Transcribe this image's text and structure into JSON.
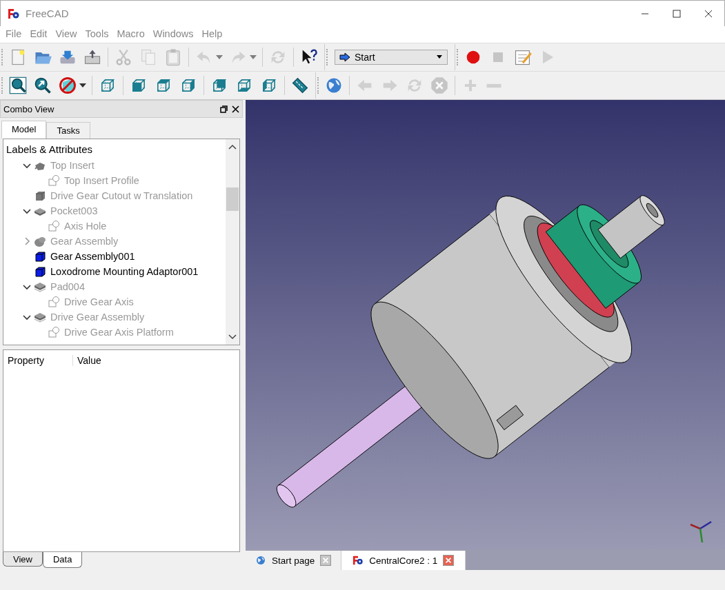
{
  "window": {
    "title": "FreeCAD"
  },
  "menu": [
    "File",
    "Edit",
    "View",
    "Tools",
    "Macro",
    "Windows",
    "Help"
  ],
  "toolbar_top": [
    {
      "kind": "new",
      "disabled": false
    },
    {
      "kind": "open",
      "disabled": false
    },
    {
      "kind": "save",
      "disabled": false
    },
    {
      "kind": "export",
      "disabled": false
    },
    {
      "kind": "sep"
    },
    {
      "kind": "cut",
      "disabled": true
    },
    {
      "kind": "copy",
      "disabled": true
    },
    {
      "kind": "paste",
      "disabled": true
    },
    {
      "kind": "sep"
    },
    {
      "kind": "undo",
      "disabled": true,
      "menu": true
    },
    {
      "kind": "redo",
      "disabled": true,
      "menu": true
    },
    {
      "kind": "sep"
    },
    {
      "kind": "refresh",
      "disabled": true
    },
    {
      "kind": "sep"
    },
    {
      "kind": "whatsthis",
      "disabled": false
    }
  ],
  "macro_toolbar": {
    "workbench": "Start",
    "buttons": [
      {
        "kind": "record",
        "disabled": false
      },
      {
        "kind": "stop",
        "disabled": true
      },
      {
        "kind": "editor",
        "disabled": false
      },
      {
        "kind": "play",
        "disabled": true
      }
    ]
  },
  "toolbar_view": [
    {
      "kind": "fit-all",
      "disabled": false
    },
    {
      "kind": "fit-selection",
      "disabled": false
    },
    {
      "kind": "drawstyle",
      "disabled": false,
      "menu": true
    },
    {
      "kind": "sep"
    },
    {
      "kind": "iso",
      "disabled": false
    },
    {
      "kind": "sep"
    },
    {
      "kind": "front",
      "disabled": false
    },
    {
      "kind": "top",
      "disabled": false
    },
    {
      "kind": "right",
      "disabled": false
    },
    {
      "kind": "sep"
    },
    {
      "kind": "rear",
      "disabled": false
    },
    {
      "kind": "bottom",
      "disabled": false
    },
    {
      "kind": "left",
      "disabled": false
    },
    {
      "kind": "sep"
    },
    {
      "kind": "measure",
      "disabled": false
    }
  ],
  "toolbar_web": [
    {
      "kind": "globe",
      "disabled": false
    },
    {
      "kind": "sep"
    },
    {
      "kind": "back",
      "disabled": true
    },
    {
      "kind": "forward",
      "disabled": true
    },
    {
      "kind": "refresh",
      "disabled": true
    },
    {
      "kind": "stop-web",
      "disabled": true
    },
    {
      "kind": "sep"
    },
    {
      "kind": "zoom-in",
      "disabled": true
    },
    {
      "kind": "zoom-out",
      "disabled": true
    }
  ],
  "combo_view": {
    "title": "Combo View",
    "tabs": [
      {
        "label": "Model",
        "selected": true
      },
      {
        "label": "Tasks",
        "selected": false
      }
    ],
    "tree": {
      "header": "Labels & Attributes",
      "items": [
        {
          "children": [
            {
              "label": "Top Insert",
              "kind": "fusion",
              "visible": false,
              "expanded": true,
              "children": [
                {
                  "label": "Top Insert Profile",
                  "kind": "sketch",
                  "visible": false
                }
              ]
            },
            {
              "label": "Drive Gear Cutout w Translation",
              "kind": "part",
              "visible": false
            }
          ]
        },
        {
          "label": "Pocket003",
          "kind": "pocket",
          "visible": false,
          "expanded": true,
          "children": [
            {
              "label": "Axis Hole",
              "kind": "sketch",
              "visible": false
            }
          ]
        },
        {
          "label": "Gear Assembly",
          "kind": "blob",
          "visible": false,
          "expanded": false
        },
        {
          "label": "Gear Assembly001",
          "kind": "body",
          "visible": true
        },
        {
          "label": "Loxodrome Mounting Adaptor001",
          "kind": "body",
          "visible": true
        },
        {
          "label": "Pad004",
          "kind": "pad",
          "visible": false,
          "expanded": true,
          "children": [
            {
              "label": "Drive Gear Axis",
              "kind": "sketch",
              "visible": false
            }
          ]
        },
        {
          "label": "Drive Gear Assembly",
          "kind": "pad",
          "visible": false,
          "expanded": true,
          "children": [
            {
              "label": "Drive Gear Axis Platform",
              "kind": "sketch",
              "visible": false
            }
          ]
        }
      ]
    },
    "property_columns": [
      "Property",
      "Value"
    ],
    "bottom_tabs": [
      {
        "label": "View",
        "selected": false
      },
      {
        "label": "Data",
        "selected": true
      }
    ]
  },
  "document_tabs": [
    {
      "label": "Start page",
      "kind": "web",
      "selected": false
    },
    {
      "label": "CentralCore2 : 1",
      "kind": "doc",
      "selected": true
    }
  ]
}
